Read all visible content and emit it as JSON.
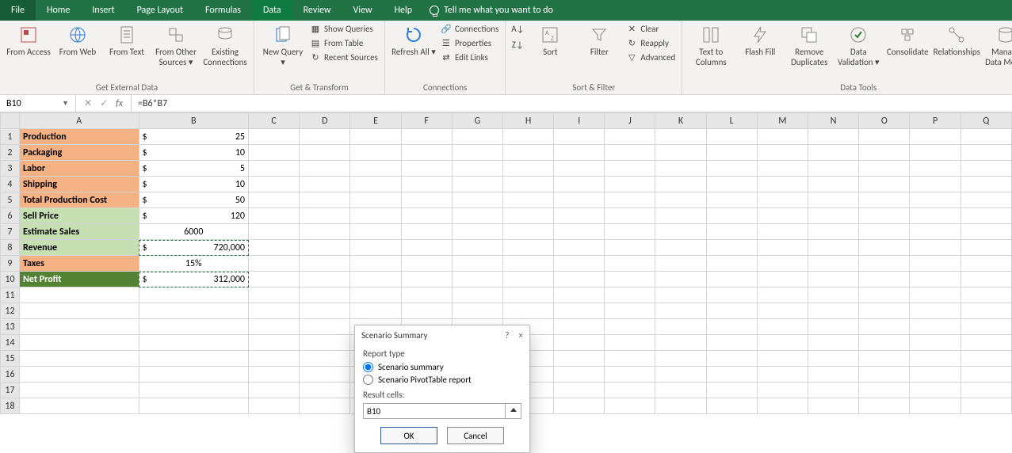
{
  "tabs": {
    "file": "File",
    "home": "Home",
    "insert": "Insert",
    "pagelayout": "Page Layout",
    "formulas": "Formulas",
    "data": "Data",
    "review": "Review",
    "view": "View",
    "help": "Help",
    "tellme": "Tell me what you want to do"
  },
  "ribbon": {
    "groups": {
      "external": {
        "label": "Get External Data",
        "from_access": "From Access",
        "from_web": "From Web",
        "from_text": "From Text",
        "from_other": "From Other Sources ▾",
        "existing": "Existing Connections"
      },
      "transform": {
        "label": "Get & Transform",
        "new_query": "New Query ▾",
        "show_queries": "Show Queries",
        "from_table": "From Table",
        "recent": "Recent Sources"
      },
      "connections": {
        "label": "Connections",
        "refresh": "Refresh All ▾",
        "connections": "Connections",
        "properties": "Properties",
        "edit_links": "Edit Links"
      },
      "sortfilter": {
        "label": "Sort & Filter",
        "az": "A→Z",
        "za": "Z→A",
        "sort": "Sort",
        "filter": "Filter",
        "clear": "Clear",
        "reapply": "Reapply",
        "advanced": "Advanced"
      },
      "datatools": {
        "label": "Data Tools",
        "ttc": "Text to Columns",
        "flash": "Flash Fill",
        "dup": "Remove Duplicates",
        "valid": "Data Validation ▾",
        "consol": "Consolidate",
        "rel": "Relationships",
        "model": "Manage Data Model"
      }
    }
  },
  "formula_bar": {
    "name": "B10",
    "fx": "fx",
    "formula": "=B6*B7"
  },
  "columns": [
    "A",
    "B",
    "C",
    "D",
    "E",
    "F",
    "G",
    "H",
    "I",
    "J",
    "K",
    "L",
    "M",
    "N",
    "O",
    "P",
    "Q"
  ],
  "rows": [
    1,
    2,
    3,
    4,
    5,
    6,
    7,
    8,
    9,
    10,
    11,
    12,
    13,
    14,
    15,
    16,
    17,
    18
  ],
  "cells": {
    "A1": "Production",
    "B1": "25",
    "A2": "Packaging",
    "B2": "10",
    "A3": "Labor",
    "B3": "5",
    "A4": "Shipping",
    "B4": "10",
    "A5": "Total Production Cost",
    "B5": "50",
    "A6": "Sell Price",
    "B6": "120",
    "A7": "Estimate Sales",
    "B7": "6000",
    "A8": "Revenue",
    "B8": "720,000",
    "A9": "Taxes",
    "B9": "15%",
    "A10": "Net Profit",
    "B10": "312,000",
    "dollar": "$"
  },
  "dialog": {
    "title": "Scenario Summary",
    "help": "?",
    "close": "×",
    "report_type_label": "Report type",
    "opt_summary": "Scenario summary",
    "opt_pivot": "Scenario PivotTable report",
    "result_label": "Result cells:",
    "result_value": "B10",
    "ok": "OK",
    "cancel": "Cancel"
  }
}
